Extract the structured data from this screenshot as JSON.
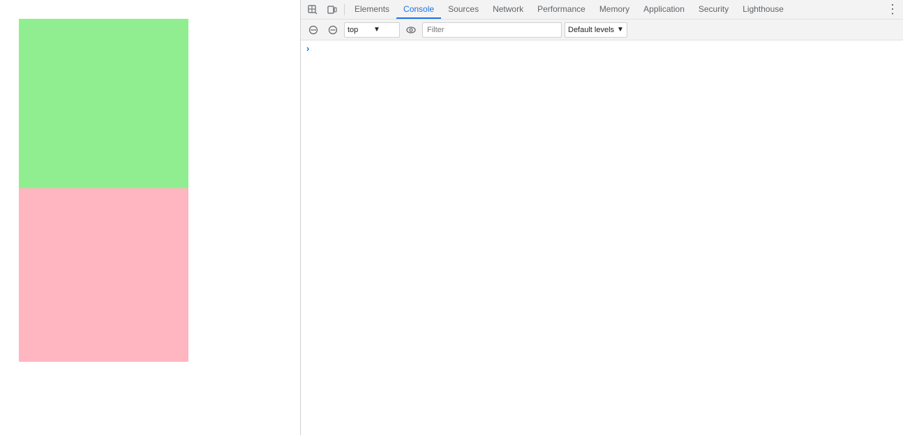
{
  "page": {
    "green_box_color": "#90ee90",
    "pink_box_color": "#ffb6c1"
  },
  "devtools": {
    "toolbar": {
      "inspect_icon": "⬚",
      "device_icon": "☐"
    },
    "tabs": [
      {
        "label": "Elements",
        "active": false
      },
      {
        "label": "Console",
        "active": true
      },
      {
        "label": "Sources",
        "active": false
      },
      {
        "label": "Network",
        "active": false
      },
      {
        "label": "Performance",
        "active": false
      },
      {
        "label": "Memory",
        "active": false
      },
      {
        "label": "Application",
        "active": false
      },
      {
        "label": "Security",
        "active": false
      },
      {
        "label": "Lighthouse",
        "active": false
      }
    ],
    "secondary": {
      "context_value": "top",
      "filter_placeholder": "Filter",
      "levels_label": "Default levels"
    }
  }
}
